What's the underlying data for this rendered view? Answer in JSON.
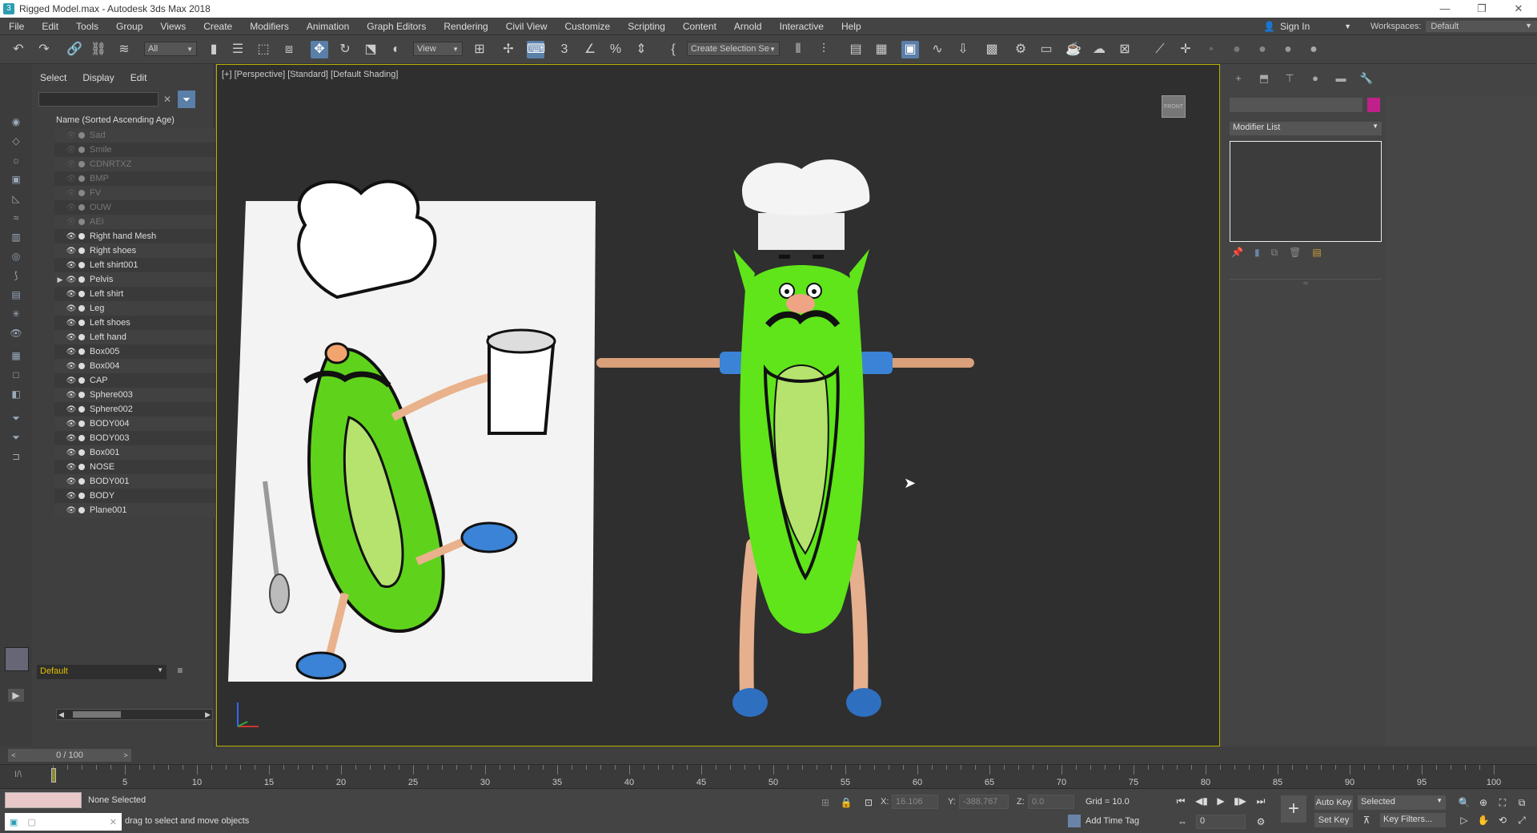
{
  "window": {
    "title": "Rigged Model.max - Autodesk 3ds Max 2018",
    "app_icon_label": "3",
    "minimize": "—",
    "restore": "❐",
    "close": "✕"
  },
  "menu": [
    "File",
    "Edit",
    "Tools",
    "Group",
    "Views",
    "Create",
    "Modifiers",
    "Animation",
    "Graph Editors",
    "Rendering",
    "Civil View",
    "Customize",
    "Scripting",
    "Content",
    "Arnold",
    "Interactive",
    "Help"
  ],
  "account": {
    "signin_label": "Sign In",
    "workspaces_label": "Workspaces:",
    "workspace_value": "Default"
  },
  "toolbar": {
    "filter_value": "All",
    "refcoord_value": "View",
    "selection_set_value": "Create Selection Se"
  },
  "explorer": {
    "tabs": [
      "Select",
      "Display",
      "Edit"
    ],
    "column_header": "Name (Sorted Ascending Age)",
    "items": [
      {
        "name": "Sad",
        "visible": false
      },
      {
        "name": "Smile",
        "visible": false
      },
      {
        "name": "CDNRTXZ",
        "visible": false
      },
      {
        "name": "BMP",
        "visible": false
      },
      {
        "name": "FV",
        "visible": false
      },
      {
        "name": "OUW",
        "visible": false
      },
      {
        "name": "AEI",
        "visible": false
      },
      {
        "name": "Right hand Mesh",
        "visible": true
      },
      {
        "name": "Right shoes",
        "visible": true
      },
      {
        "name": "Left shirt001",
        "visible": true
      },
      {
        "name": "Pelvis",
        "visible": true,
        "expandable": true
      },
      {
        "name": "Left shirt",
        "visible": true
      },
      {
        "name": "Leg",
        "visible": true
      },
      {
        "name": "Left shoes",
        "visible": true
      },
      {
        "name": "Left hand",
        "visible": true
      },
      {
        "name": "Box005",
        "visible": true
      },
      {
        "name": "Box004",
        "visible": true
      },
      {
        "name": "CAP",
        "visible": true
      },
      {
        "name": "Sphere003",
        "visible": true
      },
      {
        "name": "Sphere002",
        "visible": true
      },
      {
        "name": "BODY004",
        "visible": true
      },
      {
        "name": "BODY003",
        "visible": true
      },
      {
        "name": "Box001",
        "visible": true
      },
      {
        "name": "NOSE",
        "visible": true
      },
      {
        "name": "BODY001",
        "visible": true
      },
      {
        "name": "BODY",
        "visible": true
      },
      {
        "name": "Plane001",
        "visible": true
      }
    ],
    "layer_value": "Default"
  },
  "viewport": {
    "label": "[+] [Perspective] [Standard] [Default Shading]",
    "viewcube_label": "FRONT"
  },
  "command_panel": {
    "modifier_list_label": "Modifier List",
    "object_color": "#c0208a"
  },
  "timeline": {
    "current": "0 / 100",
    "ticks": [
      "5",
      "10",
      "15",
      "20",
      "25",
      "30",
      "35",
      "40",
      "45",
      "50",
      "55",
      "60",
      "65",
      "70",
      "75",
      "80",
      "85",
      "90",
      "95",
      "100"
    ]
  },
  "status": {
    "selection": "None Selected",
    "prompt": "drag to select and move objects",
    "x_label": "X:",
    "x_value": "16.106",
    "y_label": "Y:",
    "y_value": "-388.767",
    "z_label": "Z:",
    "z_value": "0.0",
    "grid": "Grid = 10.0",
    "add_time_tag": "Add Time Tag",
    "frame_value": "0",
    "auto_key": "Auto Key",
    "set_key": "Set Key",
    "key_mode": "Selected",
    "key_filters": "Key Filters..."
  }
}
